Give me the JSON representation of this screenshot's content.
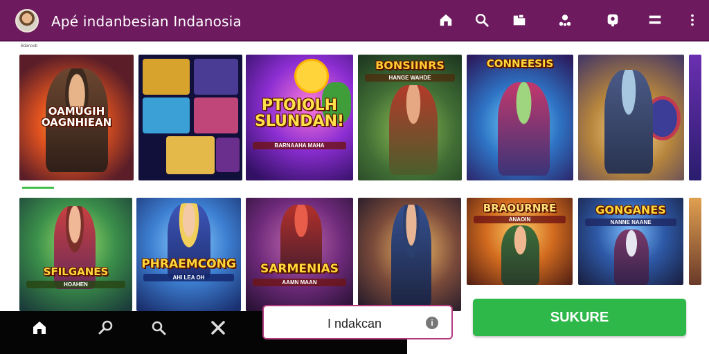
{
  "header": {
    "title": "Apé indanbesian Indanosia",
    "avatar_icon": "user-avatar",
    "icons": [
      "home-icon",
      "search-icon",
      "folder-icon",
      "people-icon",
      "badge-icon",
      "menu-icon",
      "more-vertical-icon"
    ]
  },
  "rows": [
    {
      "label": "Bdanoob"
    },
    {
      "label": ""
    }
  ],
  "tiles_row1": [
    {
      "title": "OAMUGIH OAGNHIEAN",
      "subtitle": ""
    },
    {
      "title": "",
      "subtitle": ""
    },
    {
      "title": "PTOIOLH SLUNDAN!",
      "subtitle": "BARNAAHA MAHA"
    },
    {
      "title": "BONSIINRS",
      "subtitle": "HANGE WAHDE"
    },
    {
      "title": "CONNEESIS",
      "subtitle": ""
    },
    {
      "title": "",
      "subtitle": ""
    }
  ],
  "tiles_row2": [
    {
      "title": "SFILGANES",
      "subtitle": "HOAHEN"
    },
    {
      "title": "PHRAEMCONG",
      "subtitle": "AHI LEA OH"
    },
    {
      "title": "SARMENIAS",
      "subtitle": "AAMN MAAN"
    },
    {
      "title": "",
      "subtitle": ""
    },
    {
      "title": "BRAOURNRE",
      "subtitle": "ANAOIN"
    },
    {
      "title": "GONGANES",
      "subtitle": "NANNE NAANE"
    }
  ],
  "bottom_nav": {
    "icons": [
      "home-icon",
      "search-icon",
      "search-icon",
      "tools-icon"
    ]
  },
  "search": {
    "value": "I ndakcan",
    "info_symbol": "i"
  },
  "cta": {
    "label": "SUKURE",
    "color": "#2fb84a"
  },
  "colors": {
    "header_bg": "#6d1a5e",
    "title_text": "#ffd93a"
  }
}
